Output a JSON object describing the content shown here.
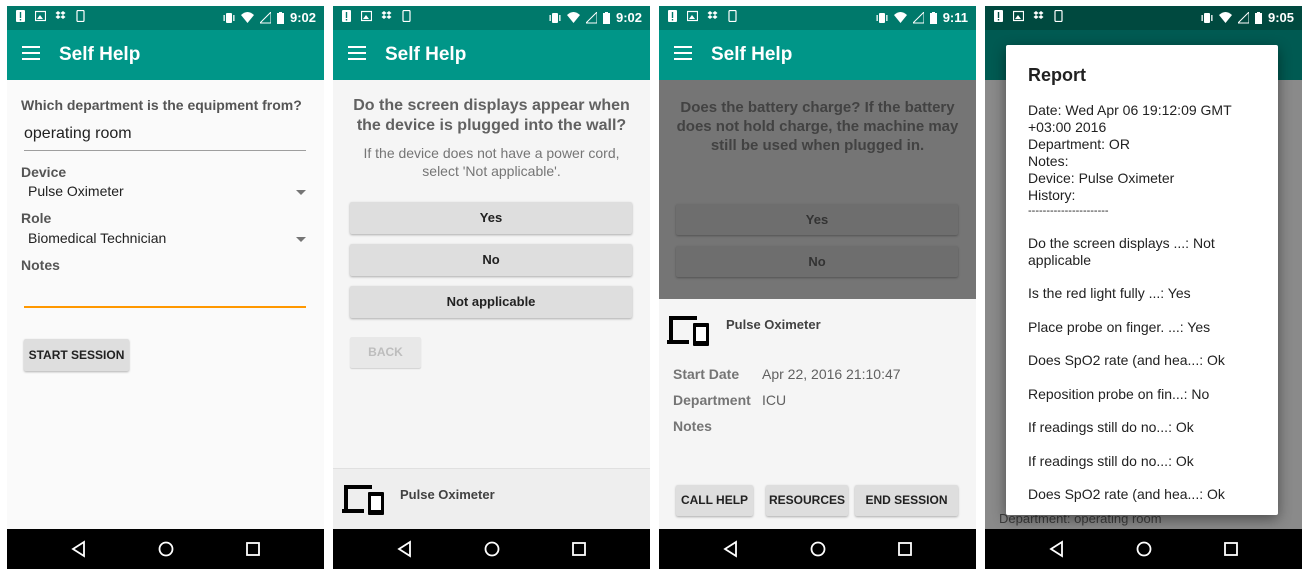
{
  "status_time": [
    "9:02",
    "9:02",
    "9:11",
    "9:05"
  ],
  "app_title": "Self Help",
  "screen1": {
    "question": "Which department is the equipment from?",
    "department_value": "operating room",
    "device_label": "Device",
    "device_value": "Pulse Oximeter",
    "role_label": "Role",
    "role_value": "Biomedical Technician",
    "notes_label": "Notes",
    "notes_value": "",
    "start_button": "START SESSION"
  },
  "screen2": {
    "question": "Do the screen displays appear when the device is plugged into the wall?",
    "hint": "If the device does not have a power cord, select 'Not applicable'.",
    "options": [
      "Yes",
      "No",
      "Not applicable"
    ],
    "back_button": "BACK",
    "device_name": "Pulse Oximeter"
  },
  "screen3": {
    "question": "Does the battery charge? If the battery does not hold charge, the machine may still be used when plugged in.",
    "options": [
      "Yes",
      "No"
    ],
    "device_name": "Pulse Oximeter",
    "start_date_label": "Start Date",
    "start_date_value": "Apr 22, 2016 21:10:47",
    "department_label": "Department",
    "department_value": "ICU",
    "notes_label": "Notes",
    "buttons": [
      "CALL HELP",
      "RESOURCES",
      "END SESSION"
    ]
  },
  "screen4": {
    "dialog_title": "Report",
    "header_lines": [
      "Date: Wed Apr 06 19:12:09 GMT +03:00 2016",
      "Department: OR",
      "Notes:",
      "Device: Pulse Oximeter",
      "History:",
      "----------------------"
    ],
    "history_items": [
      "Do the screen displays ...: Not applicable",
      "Is the red light fully ...: Yes",
      "Place probe on finger. ...: Yes",
      "Does SpO2 rate (and hea...: Ok",
      "Reposition probe on fin...: No",
      "If readings still do no...: Ok",
      "If readings still do no...: Ok",
      "Does SpO2 rate (and hea...: Ok"
    ],
    "background_text": "Department: operating room"
  },
  "colors": {
    "primary": "#009688",
    "primary_dark": "#00796b",
    "accent": "#ff9800"
  }
}
